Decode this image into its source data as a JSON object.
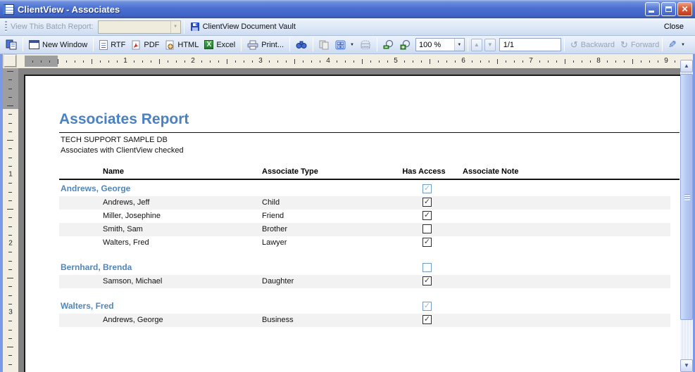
{
  "window": {
    "title": "ClientView - Associates"
  },
  "batch_bar": {
    "label": "View This Batch Report:",
    "dropdown_value": "",
    "vault": "ClientView Document Vault",
    "close": "Close"
  },
  "toolbar": {
    "new_window": "New Window",
    "rtf": "RTF",
    "pdf": "PDF",
    "html": "HTML",
    "excel": "Excel",
    "print": "Print...",
    "zoom": "100 %",
    "pages": "1/1",
    "backward": "Backward",
    "forward": "Forward"
  },
  "ruler": {
    "h_numbers": [
      "1",
      "2",
      "3",
      "4",
      "5",
      "6",
      "7",
      "8",
      "9"
    ],
    "v_numbers": [
      "1",
      "2",
      "3"
    ]
  },
  "report": {
    "title": "Associates Report",
    "db_line": "TECH SUPPORT SAMPLE DB",
    "filter_line": "Associates with ClientView checked",
    "columns": [
      "Name",
      "Associate Type",
      "Has Access",
      "Associate Note"
    ],
    "groups": [
      {
        "name": "Andrews, George",
        "has_access": true,
        "rows": [
          {
            "name": "Andrews, Jeff",
            "type": "Child",
            "has_access": true,
            "note": ""
          },
          {
            "name": "Miller, Josephine",
            "type": "Friend",
            "has_access": true,
            "note": ""
          },
          {
            "name": "Smith, Sam",
            "type": "Brother",
            "has_access": false,
            "note": ""
          },
          {
            "name": "Walters, Fred",
            "type": "Lawyer",
            "has_access": true,
            "note": ""
          }
        ]
      },
      {
        "name": "Bernhard, Brenda",
        "has_access": false,
        "rows": [
          {
            "name": "Samson, Michael",
            "type": "Daughter",
            "has_access": true,
            "note": ""
          }
        ]
      },
      {
        "name": "Walters, Fred",
        "has_access": true,
        "rows": [
          {
            "name": "Andrews, George",
            "type": "Business",
            "has_access": true,
            "note": ""
          }
        ]
      }
    ]
  },
  "colors": {
    "titlebar_blue": "#4b70d1",
    "toolbar_bg": "#dde8f7",
    "report_heading_blue": "#4a80c4",
    "group_name_blue": "#4f86bb",
    "row_stripe": "#f2f2f2",
    "workspace_gray": "#828282",
    "ruler_beige": "#f2efe2",
    "close_button_red": "#bf3a1c"
  }
}
